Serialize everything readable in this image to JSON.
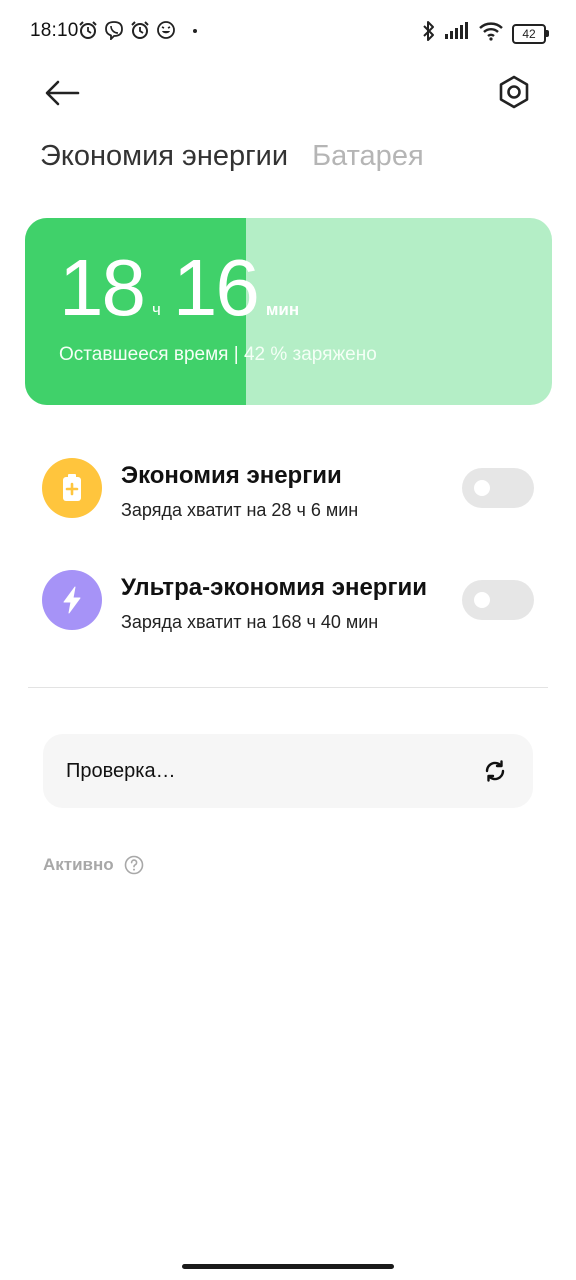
{
  "status_bar": {
    "time": "18:10",
    "battery_level": "42",
    "icons": [
      "alarm-icon",
      "viber-icon",
      "alarm-icon",
      "emoji-icon",
      "bluetooth-icon",
      "signal-icon",
      "wifi-icon",
      "battery-icon"
    ]
  },
  "header": {
    "tabs": [
      {
        "label": "Экономия энергии",
        "active": true
      },
      {
        "label": "Батарея",
        "active": false
      }
    ]
  },
  "battery_card": {
    "hours": "18",
    "hours_unit": "ч",
    "minutes": "16",
    "minutes_unit": "мин",
    "subtitle": "Оставшееся время | 42 % заряжено",
    "charge_fraction": 0.42,
    "fill_color": "#40d16a",
    "track_color": "#b4eec6"
  },
  "modes": [
    {
      "title": "Экономия энергии",
      "subtitle": "Заряда хватит на 28 ч 6 мин",
      "icon": "battery-plus-icon",
      "icon_color": "#ffc53d",
      "enabled": false
    },
    {
      "title": "Ультра-экономия энергии",
      "subtitle": "Заряда хватит на 168 ч 40 мин",
      "icon": "lightning-icon",
      "icon_color": "#a693f7",
      "enabled": false
    }
  ],
  "scan": {
    "label": "Проверка…",
    "icon": "refresh-icon"
  },
  "active_section": {
    "label": "Активно",
    "icon": "help-icon"
  }
}
